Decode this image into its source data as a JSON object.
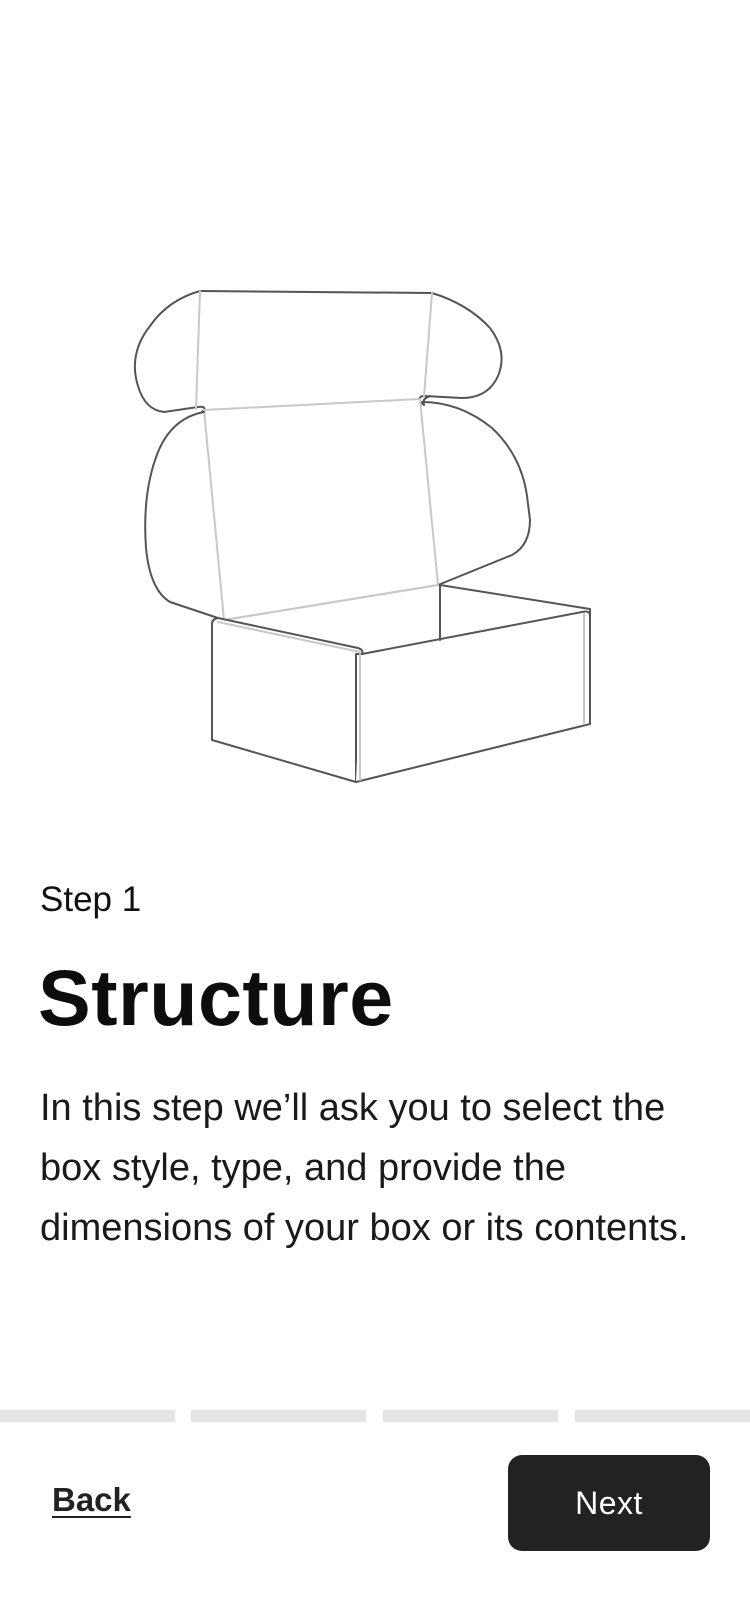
{
  "illustration": {
    "icon": "mailer-box-illustration",
    "stroke_color": "#555555",
    "fold_color": "#c8c8c8"
  },
  "step": {
    "label": "Step 1",
    "title": "Structure",
    "description": "In this step we’ll ask you to select the box style, type, and provide the dimensions of your box or its contents."
  },
  "progress": {
    "total_steps": 4,
    "current_step": 1,
    "track_color": "#e5e5e5"
  },
  "footer": {
    "back_label": "Back",
    "next_label": "Next",
    "button_color": "#222222"
  }
}
